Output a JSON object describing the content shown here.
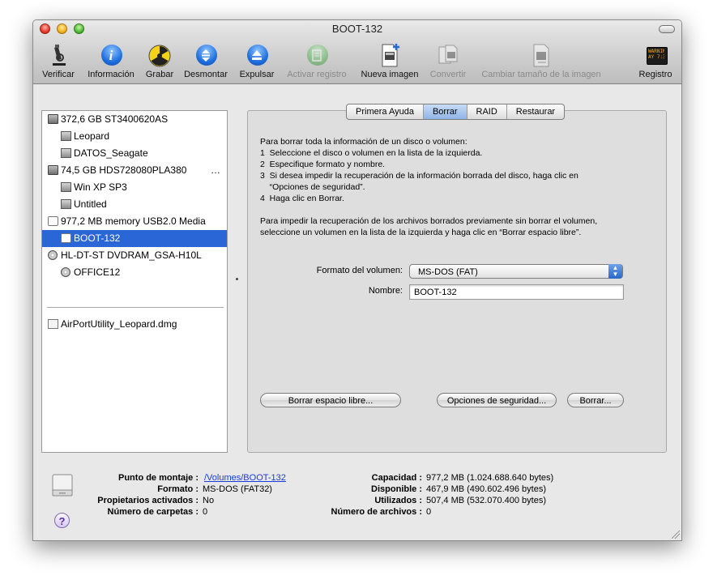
{
  "window": {
    "title": "BOOT-132"
  },
  "toolbar": {
    "items": [
      {
        "label": "Verificar",
        "icon": "microscope-icon",
        "enabled": true
      },
      {
        "label": "Información",
        "icon": "info-icon",
        "enabled": true
      },
      {
        "label": "Grabar",
        "icon": "burn-icon",
        "enabled": true
      },
      {
        "label": "Desmontar",
        "icon": "unmount-icon",
        "enabled": true
      },
      {
        "label": "Expulsar",
        "icon": "eject-icon",
        "enabled": true
      },
      {
        "label": "Activar registro",
        "icon": "journaling-icon",
        "enabled": false
      },
      {
        "label": "Nueva imagen",
        "icon": "new-image-icon",
        "enabled": true
      },
      {
        "label": "Convertir",
        "icon": "convert-icon",
        "enabled": false
      },
      {
        "label": "Cambiar tamaño de la imagen",
        "icon": "resize-image-icon",
        "enabled": false
      },
      {
        "label": "Registro",
        "icon": "log-icon",
        "enabled": true
      }
    ],
    "log_icon_text": "WARNIN\nAY 7:36"
  },
  "sidebar": {
    "items": [
      {
        "label": "372,6 GB ST3400620AS",
        "kind": "disk"
      },
      {
        "label": "Leopard",
        "kind": "volume"
      },
      {
        "label": "DATOS_Seagate",
        "kind": "volume"
      },
      {
        "label": "74,5 GB HDS728080PLA380",
        "suffix": "…",
        "kind": "disk"
      },
      {
        "label": "Win XP SP3",
        "kind": "volume"
      },
      {
        "label": "Untitled",
        "kind": "volume"
      },
      {
        "label": "977,2 MB memory USB2.0 Media",
        "kind": "usb"
      },
      {
        "label": "BOOT-132",
        "kind": "usb-volume",
        "selected": true
      },
      {
        "label": "HL-DT-ST DVDRAM_GSA-H10L",
        "kind": "optical"
      },
      {
        "label": "OFFICE12",
        "kind": "optical-volume"
      },
      {
        "label": "AirPortUtility_Leopard.dmg",
        "kind": "image"
      }
    ]
  },
  "tabs": [
    {
      "label": "Primera Ayuda"
    },
    {
      "label": "Borrar",
      "active": true
    },
    {
      "label": "RAID"
    },
    {
      "label": "Restaurar"
    }
  ],
  "erase": {
    "instructions": "Para borrar toda la información de un disco o volumen:\n1  Seleccione el disco o volumen en la lista de la izquierda.\n2  Especifique formato y nombre.\n3  Si desea impedir la recuperación de la información borrada del disco, haga clic en\n    “Opciones de seguridad”.\n4  Haga clic en Borrar.\n\nPara impedir la recuperación de los archivos borrados previamente sin borrar el volumen,\nseleccione un volumen en la lista de la izquierda y haga clic en “Borrar espacio libre”.",
    "format_label": "Formato del volumen:",
    "format_value": "MS-DOS (FAT)",
    "name_label": "Nombre:",
    "name_value": "BOOT-132",
    "erase_free_label": "Borrar espacio libre...",
    "security_label": "Opciones de seguridad...",
    "erase_label": "Borrar..."
  },
  "info": {
    "mount_label": "Punto de montaje :",
    "mount_value": "/Volumes/BOOT-132",
    "format_label": "Formato :",
    "format_value": "MS-DOS (FAT32)",
    "owners_label": "Propietarios activados :",
    "owners_value": "No",
    "folders_label": "Número de carpetas :",
    "folders_value": "0",
    "capacity_label": "Capacidad :",
    "capacity_value": "977,2 MB (1.024.688.640 bytes)",
    "available_label": "Disponible :",
    "available_value": "467,9 MB (490.602.496 bytes)",
    "used_label": "Utilizados :",
    "used_value": "507,4 MB (532.070.400 bytes)",
    "files_label": "Número de archivos :",
    "files_value": "0",
    "help": "?"
  }
}
